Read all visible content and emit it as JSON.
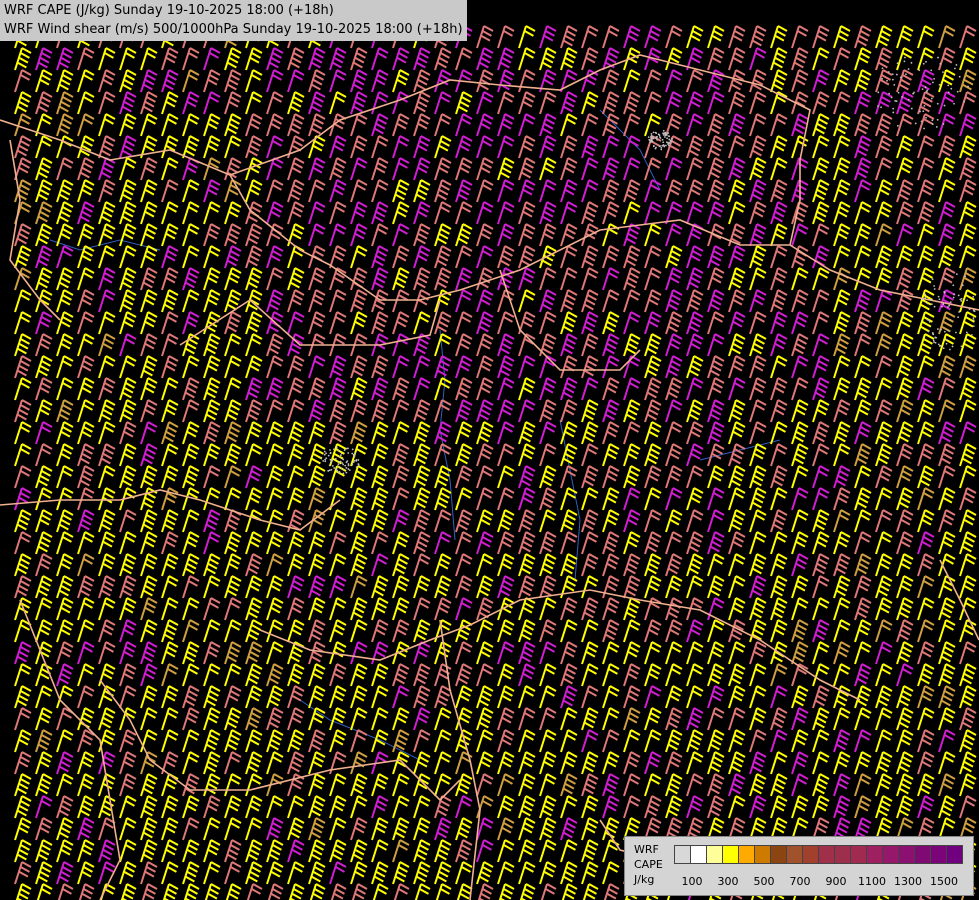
{
  "titles": {
    "line1": "WRF CAPE (J/kg) Sunday 19-10-2025 18:00 (+18h)",
    "line2": "WRF Wind shear (m/s) 500/1000hPa Sunday 19-10-2025 18:00 (+18h)"
  },
  "legend": {
    "model_label": "WRF",
    "field_label": "CAPE",
    "unit_label": "J/kg",
    "colors": [
      "#d8d8d8",
      "#ffffff",
      "#ffff99",
      "#ffff00",
      "#ffaa00",
      "#cc7a00",
      "#8b4513",
      "#a0522d",
      "#a0402d",
      "#a0304a",
      "#9e2f4c",
      "#a02a50",
      "#9e2060",
      "#96186a",
      "#8c1070",
      "#800a74",
      "#7a0478",
      "#700080"
    ],
    "ticks": [
      "100",
      "300",
      "500",
      "700",
      "900",
      "1100",
      "1300",
      "1500"
    ]
  },
  "barb_palette": {
    "low": "#ffff00",
    "mid": "#e07878",
    "high": "#d21ed2",
    "warm": "#d0a040"
  },
  "map_colors": {
    "background": "#000000",
    "borders": "#f0b090",
    "rivers": "#3060c0",
    "convection_dots": "#c0c0c0"
  }
}
